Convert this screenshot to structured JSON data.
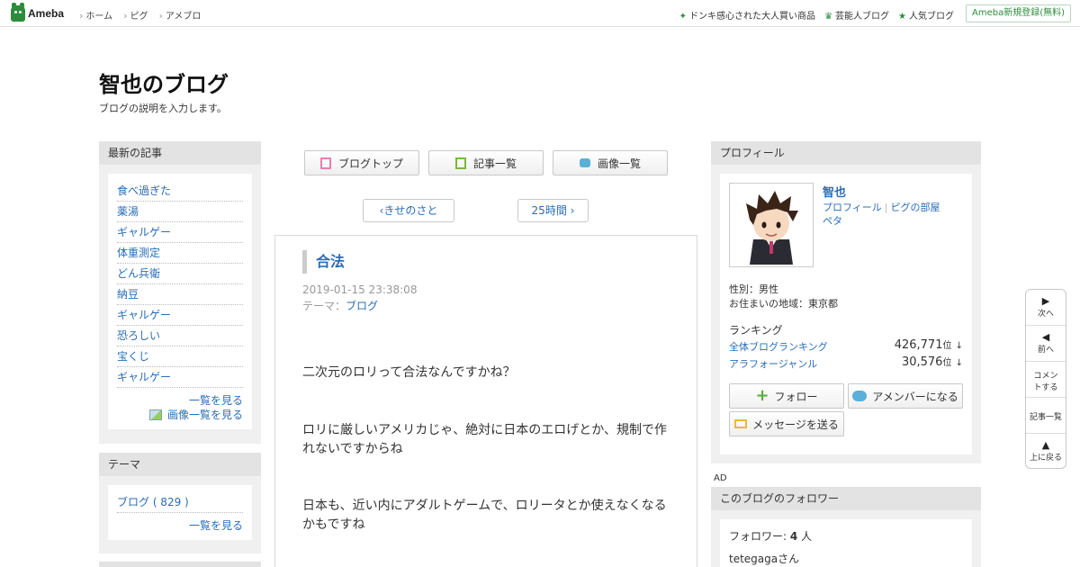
{
  "topbar": {
    "logo_text": "Ameba",
    "nav_left": [
      "ホーム",
      "ピグ",
      "アメブロ"
    ],
    "nav_right": [
      {
        "icon": "sparkle-icon",
        "label": "ドンキ感心された大人買い商品"
      },
      {
        "icon": "crown-icon",
        "label": "芸能人ブログ"
      },
      {
        "icon": "star-icon",
        "label": "人気ブログ"
      }
    ],
    "register_label": "Ameba新規登録(無料)"
  },
  "blog": {
    "title": "智也のブログ",
    "description": "ブログの説明を入力します。"
  },
  "latest": {
    "heading": "最新の記事",
    "items": [
      "食べ過ぎた",
      "薬湯",
      "ギャルゲー",
      "体重測定",
      "どん兵衛",
      "納豆",
      "ギャルゲー",
      "恐ろしい",
      "宝くじ",
      "ギャルゲー"
    ],
    "more_label": "一覧を見る",
    "images_label": "画像一覧を見る"
  },
  "theme_box": {
    "heading": "テーマ",
    "items": [
      "ブログ ( 829 )"
    ],
    "more_label": "一覧を見る"
  },
  "tabs": [
    {
      "label": "ブログトップ",
      "icon": "page-icon"
    },
    {
      "label": "記事一覧",
      "icon": "list-icon"
    },
    {
      "label": "画像一覧",
      "icon": "camera-icon"
    }
  ],
  "pager": {
    "prev": "きせのさと",
    "next": "25時間"
  },
  "article": {
    "title": "合法",
    "date": "2019-01-15 23:38:08",
    "theme_prefix": "テーマ：",
    "theme": "ブログ",
    "paragraphs": [
      "二次元のロリって合法なんですかね？",
      "ロリに厳しいアメリカじゃ、絶対に日本のエロげとか、規制で作れないですからね",
      "日本も、近い内にアダルトゲームで、ロリータとか使えなくなるかもですね"
    ]
  },
  "profile": {
    "heading": "プロフィール",
    "name": "智也",
    "links": [
      "プロフィール",
      "ピグの部屋",
      "ペタ"
    ],
    "gender": "性別：男性",
    "location": "お住まいの地域：東京都",
    "ranking_heading": "ランキング",
    "rankings": [
      {
        "label": "全体ブログランキング",
        "value": "426,771",
        "unit": "位",
        "trend": "↓"
      },
      {
        "label": "アラフォージャンル",
        "value": "30,576",
        "unit": "位",
        "trend": "↓"
      }
    ],
    "follow_label": "フォロー",
    "amember_label": "アメンバーになる",
    "message_label": "メッセージを送る"
  },
  "ad_label": "AD",
  "followers": {
    "heading": "このブログのフォロワー",
    "count_prefix": "フォロワー: ",
    "count": "4",
    "count_suffix": " 人",
    "first": "tetegagaさん"
  },
  "floatnav": {
    "next": "次へ",
    "prev": "前へ",
    "comment": "コメントする",
    "list": "記事一覧",
    "top": "上に戻る"
  },
  "colors": {
    "brand_green": "#2d8c3c",
    "link_blue": "#2a6db5"
  }
}
